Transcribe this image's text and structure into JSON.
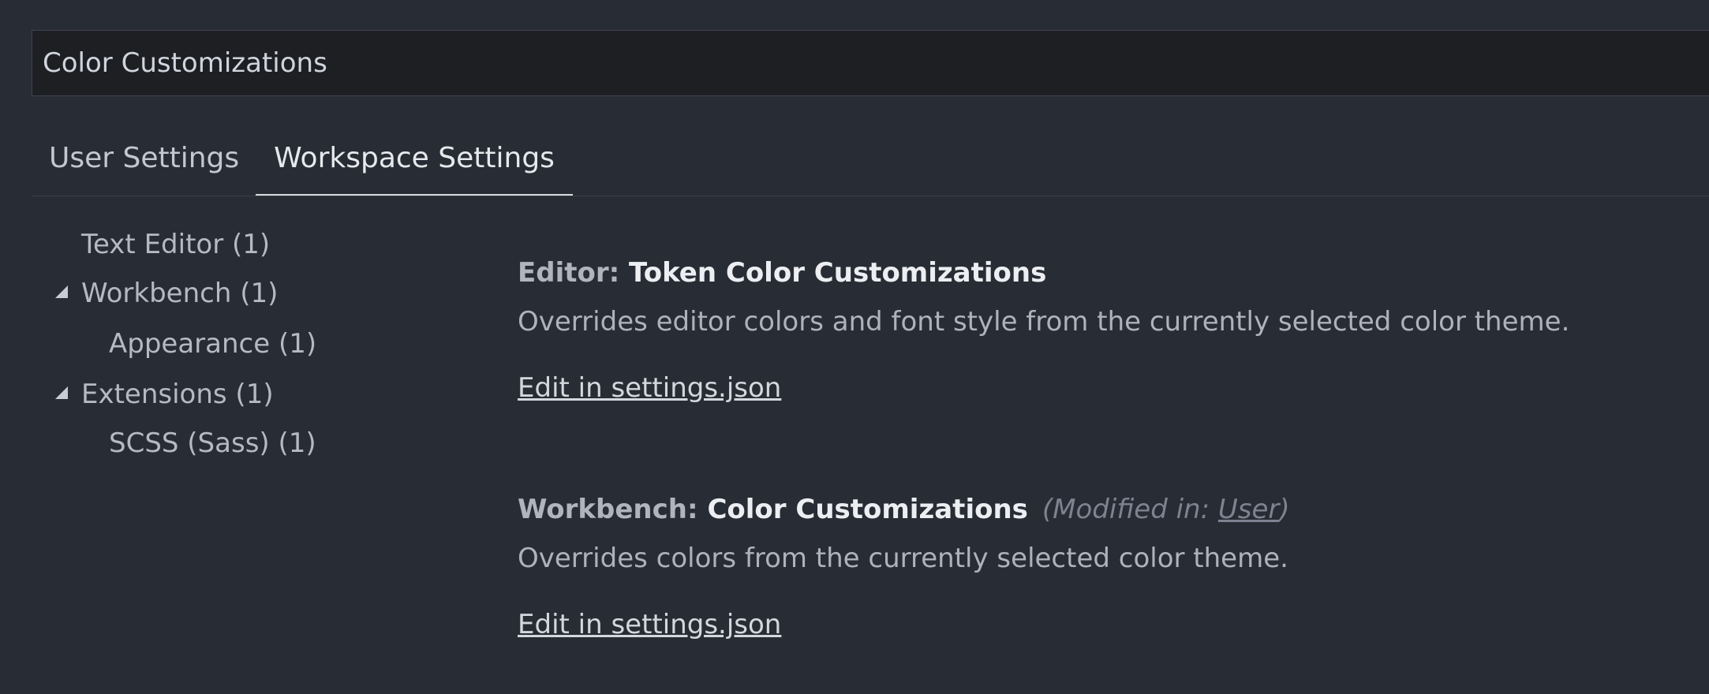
{
  "search": {
    "value": "Color Customizations",
    "placeholder": ""
  },
  "tabs": [
    {
      "label": "User Settings",
      "active": false
    },
    {
      "label": "Workspace Settings",
      "active": true
    }
  ],
  "tree": [
    {
      "label": "Text Editor (1)",
      "expanded": null
    },
    {
      "label": "Workbench (1)",
      "expanded": true
    },
    {
      "label": "Appearance (1)",
      "expanded": null
    },
    {
      "label": "Extensions (1)",
      "expanded": true
    },
    {
      "label": "SCSS (Sass) (1)",
      "expanded": null
    }
  ],
  "settings": [
    {
      "category": "Editor: ",
      "name": "Token Color Customizations",
      "description": "Overrides editor colors and font style from the currently selected color theme.",
      "link": "Edit in settings.json"
    },
    {
      "category": "Workbench: ",
      "name": "Color Customizations",
      "modified_prefix": "(Modified in: ",
      "modified_link": "User",
      "modified_suffix": ")",
      "description": "Overrides colors from the currently selected color theme.",
      "link": "Edit in settings.json"
    }
  ],
  "colors": {
    "background": "#282c34",
    "search_background": "#1e1f23",
    "active_tab_underline": "#d7dae0"
  },
  "icons": {
    "tree_expanded": "triangle-expanded-icon"
  }
}
